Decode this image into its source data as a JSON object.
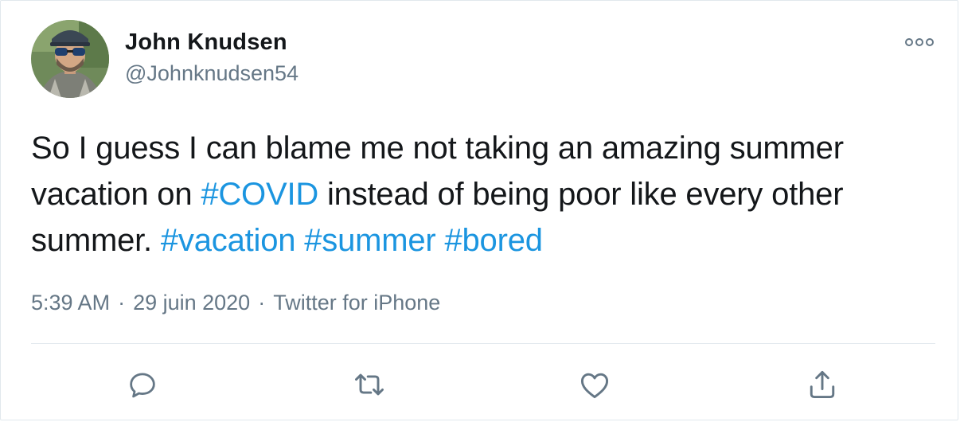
{
  "tweet": {
    "author": {
      "display_name": "John Knudsen",
      "handle": "@Johnknudsen54"
    },
    "text_segments": [
      {
        "text": "So I guess I can blame me not taking an amazing summer vacation on ",
        "hashtag": false
      },
      {
        "text": "#COVID",
        "hashtag": true
      },
      {
        "text": " instead of being poor like every other summer. ",
        "hashtag": false
      },
      {
        "text": "#vacation",
        "hashtag": true
      },
      {
        "text": " ",
        "hashtag": false
      },
      {
        "text": "#summer",
        "hashtag": true
      },
      {
        "text": " ",
        "hashtag": false
      },
      {
        "text": "#bored",
        "hashtag": true
      }
    ],
    "time": "5:39 AM",
    "date": "29 juin 2020",
    "source": "Twitter for iPhone",
    "separator": "·"
  },
  "actions": [
    {
      "name": "reply-icon"
    },
    {
      "name": "retweet-icon"
    },
    {
      "name": "like-icon"
    },
    {
      "name": "share-icon"
    }
  ],
  "colors": {
    "text": "#14171a",
    "secondary": "#657786",
    "link": "#1b95e0",
    "border": "#e1e8ed"
  }
}
